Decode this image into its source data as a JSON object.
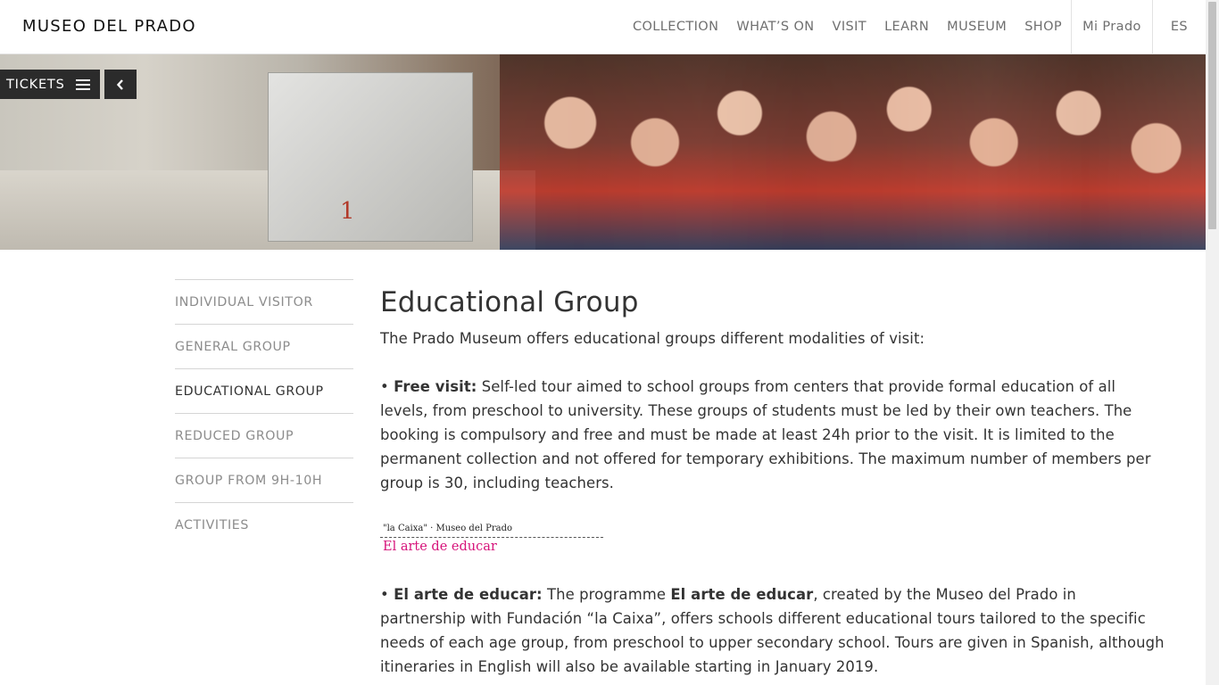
{
  "header": {
    "logo": "MUSEO DEL PRADO",
    "nav": [
      "COLLECTION",
      "WHAT’S ON",
      "VISIT",
      "LEARN",
      "MUSEUM",
      "SHOP"
    ],
    "account": "Mi Prado",
    "language": "ES"
  },
  "toolbar": {
    "tickets_label": "TICKETS",
    "tickets_icon": "menu-icon",
    "back_icon": "chevron-left-icon"
  },
  "sidebar": {
    "items": [
      {
        "label": "INDIVIDUAL VISITOR",
        "active": false
      },
      {
        "label": "GENERAL GROUP",
        "active": false
      },
      {
        "label": "EDUCATIONAL GROUP",
        "active": true
      },
      {
        "label": "REDUCED GROUP",
        "active": false
      },
      {
        "label": "GROUP FROM 9H-10H",
        "active": false
      },
      {
        "label": "ACTIVITIES",
        "active": false
      }
    ]
  },
  "main": {
    "title": "Educational Group",
    "intro": "The Prado Museum offers educational groups different modalities of visit:",
    "free_visit": {
      "bullet": "• ",
      "heading": "Free visit:",
      "text": " Self-led tour aimed to school groups from centers that provide formal education of all levels, from preschool to university. These groups of students must be led by their own teachers. The booking is compulsory and free and must be made at least 24h prior to the visit. It is limited to the permanent collection and not offered for temporary exhibitions. The maximum number of members per group is 30, including teachers."
    },
    "programme_logo": {
      "top": "\"la Caixa\" · Museo del Prado",
      "bottom": "El arte de educar"
    },
    "arte_de_educar": {
      "bullet": "• ",
      "heading": "El arte de educar:",
      "text_a": " The programme ",
      "name": "El arte de educar",
      "text_b": ", created by the Museo del Prado in partnership with Fundación “la Caixa”, offers schools different educational tours tailored to the specific needs of each age group, from preschool to upper secondary school. Tours are given in Spanish, although itineraries in English will also be available starting in January 2019."
    }
  },
  "colors": {
    "text": "#333333",
    "muted": "#8c8c8c",
    "ticket_bar": "#2b2b2b",
    "logo_accent": "#d6137a"
  }
}
